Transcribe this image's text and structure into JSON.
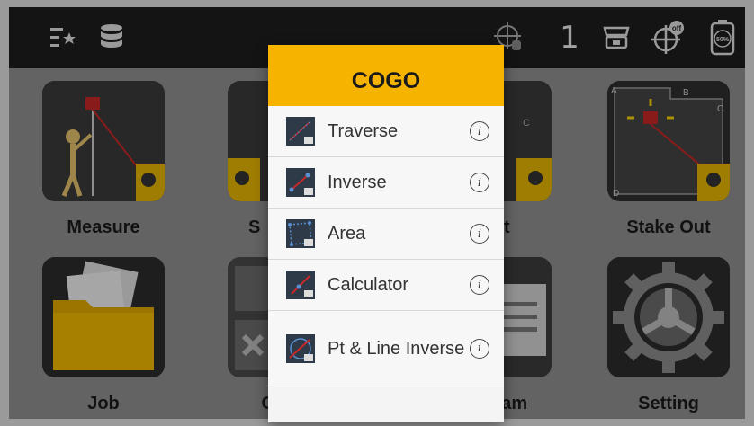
{
  "topbar": {
    "station_count": "1",
    "battery_percent": "50%",
    "gnss_status": "off"
  },
  "tiles": [
    {
      "label": "Measure"
    },
    {
      "label": "S"
    },
    {
      "label": "t"
    },
    {
      "label": "Stake Out"
    },
    {
      "label": "Job"
    },
    {
      "label": "COGO"
    },
    {
      "label": "Program"
    },
    {
      "label": "Setting"
    }
  ],
  "dialog": {
    "title": "COGO",
    "items": [
      {
        "label": "Traverse",
        "icon": "traverse-icon"
      },
      {
        "label": "Inverse",
        "icon": "inverse-icon"
      },
      {
        "label": "Area",
        "icon": "area-icon"
      },
      {
        "label": "Calculator",
        "icon": "calculator-icon"
      },
      {
        "label": "Pt & Line Inverse",
        "icon": "pt-line-inverse-icon"
      }
    ],
    "info_glyph": "i"
  },
  "stakeout_corner_labels": [
    "A",
    "B",
    "C",
    "D"
  ],
  "colors": {
    "accent": "#f6b400",
    "topbar": "#1e1e1e",
    "tile_bg": "#2b2b2b"
  }
}
